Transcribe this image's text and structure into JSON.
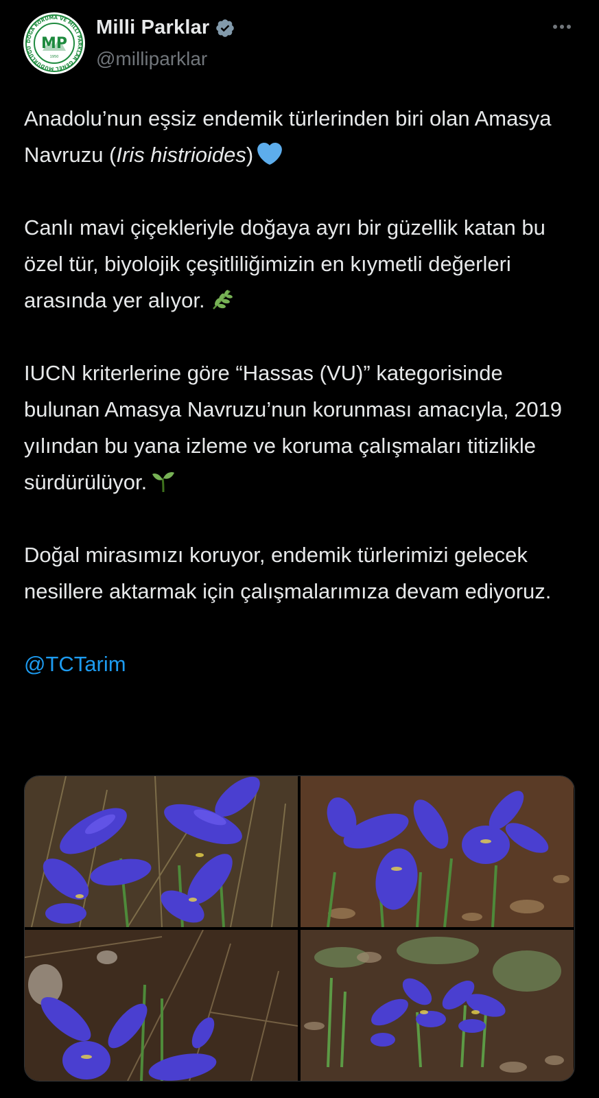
{
  "author": {
    "display_name": "Milli Parklar",
    "handle": "@milliparklar",
    "avatar_logo_text": "MP",
    "avatar_ring_text": "DOĞA KORUMA VE MİLLİ PARKLAR GENEL MÜDÜRLÜĞÜ",
    "avatar_year": "1950",
    "verified_badge_icon": "verified-badge-icon",
    "more_icon": "more-options-icon"
  },
  "tweet": {
    "paragraph1": {
      "before_italic": "Anadolu’nun eşsiz endemik türlerinden biri olan Amasya Navruzu (",
      "italic": "Iris histrioides",
      "after_italic": ")",
      "emoji": "blue-heart-icon"
    },
    "paragraph2": {
      "text": "Canlı mavi çiçekleriyle doğaya ayrı bir güzellik katan bu özel tür, biyolojik çeşitliliğimizin en kıymetli değerleri arasında yer alıyor.",
      "emoji": "herb-icon"
    },
    "paragraph3": {
      "text": "IUCN kriterlerine göre “Hassas (VU)” kategorisinde bulunan Amasya Navruzu’nun korunması amacıyla, 2019 yılından bu yana izleme ve koruma çalışmaları titizlikle sürdürülüyor.",
      "emoji": "seedling-icon"
    },
    "paragraph4": {
      "text": "Doğal mirasımızı koruyor, endemik türlerimizi gelecek nesillere aktarmak için çalışmalarımıza devam ediyoruz."
    },
    "mention": "@TCTarim"
  },
  "media": {
    "count": 4,
    "photos": [
      "iris-photo-1",
      "iris-photo-2",
      "iris-photo-3",
      "iris-photo-4"
    ]
  },
  "colors": {
    "background": "#000000",
    "text": "#e7e9ea",
    "secondary_text": "#71767b",
    "link": "#1d9bf0",
    "verified": "#829aab",
    "iris_blue": "#4a3fd0",
    "soil": "#5a3b26"
  }
}
